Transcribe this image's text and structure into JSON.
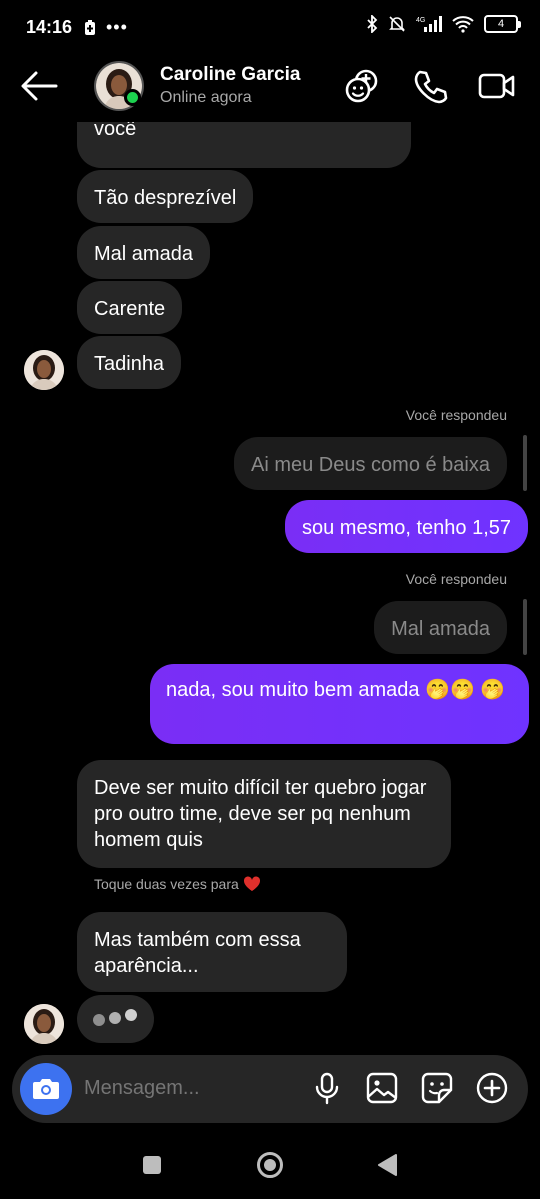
{
  "status": {
    "time": "14:16",
    "battery": "4",
    "network": "4G"
  },
  "header": {
    "name": "Caroline Garcia",
    "subtitle": "Online agora"
  },
  "messages": {
    "m1": "você",
    "m2": "Tão desprezível",
    "m3": "Mal amada",
    "m4": "Carente",
    "m5": "Tadinha",
    "reply_label_1": "Você respondeu",
    "quote_1": "Ai meu Deus como é baixa",
    "out_1": "sou mesmo, tenho 1,57",
    "reply_label_2": "Você respondeu",
    "quote_2": "Mal amada",
    "out_2": "nada, sou muito bem amada 🤭🤭 🤭",
    "m6": "Deve ser muito difícil ter quebro jogar pro outro time, deve ser pq nenhum homem quis",
    "double_tap_hint": "Toque duas vezes para",
    "m7": "Mas também com essa aparência..."
  },
  "composer": {
    "placeholder": "Mensagem..."
  },
  "colors": {
    "accent": "#7b2ff7",
    "online": "#1cd14f",
    "camera": "#3d72f0",
    "heart": "#e0302c"
  }
}
